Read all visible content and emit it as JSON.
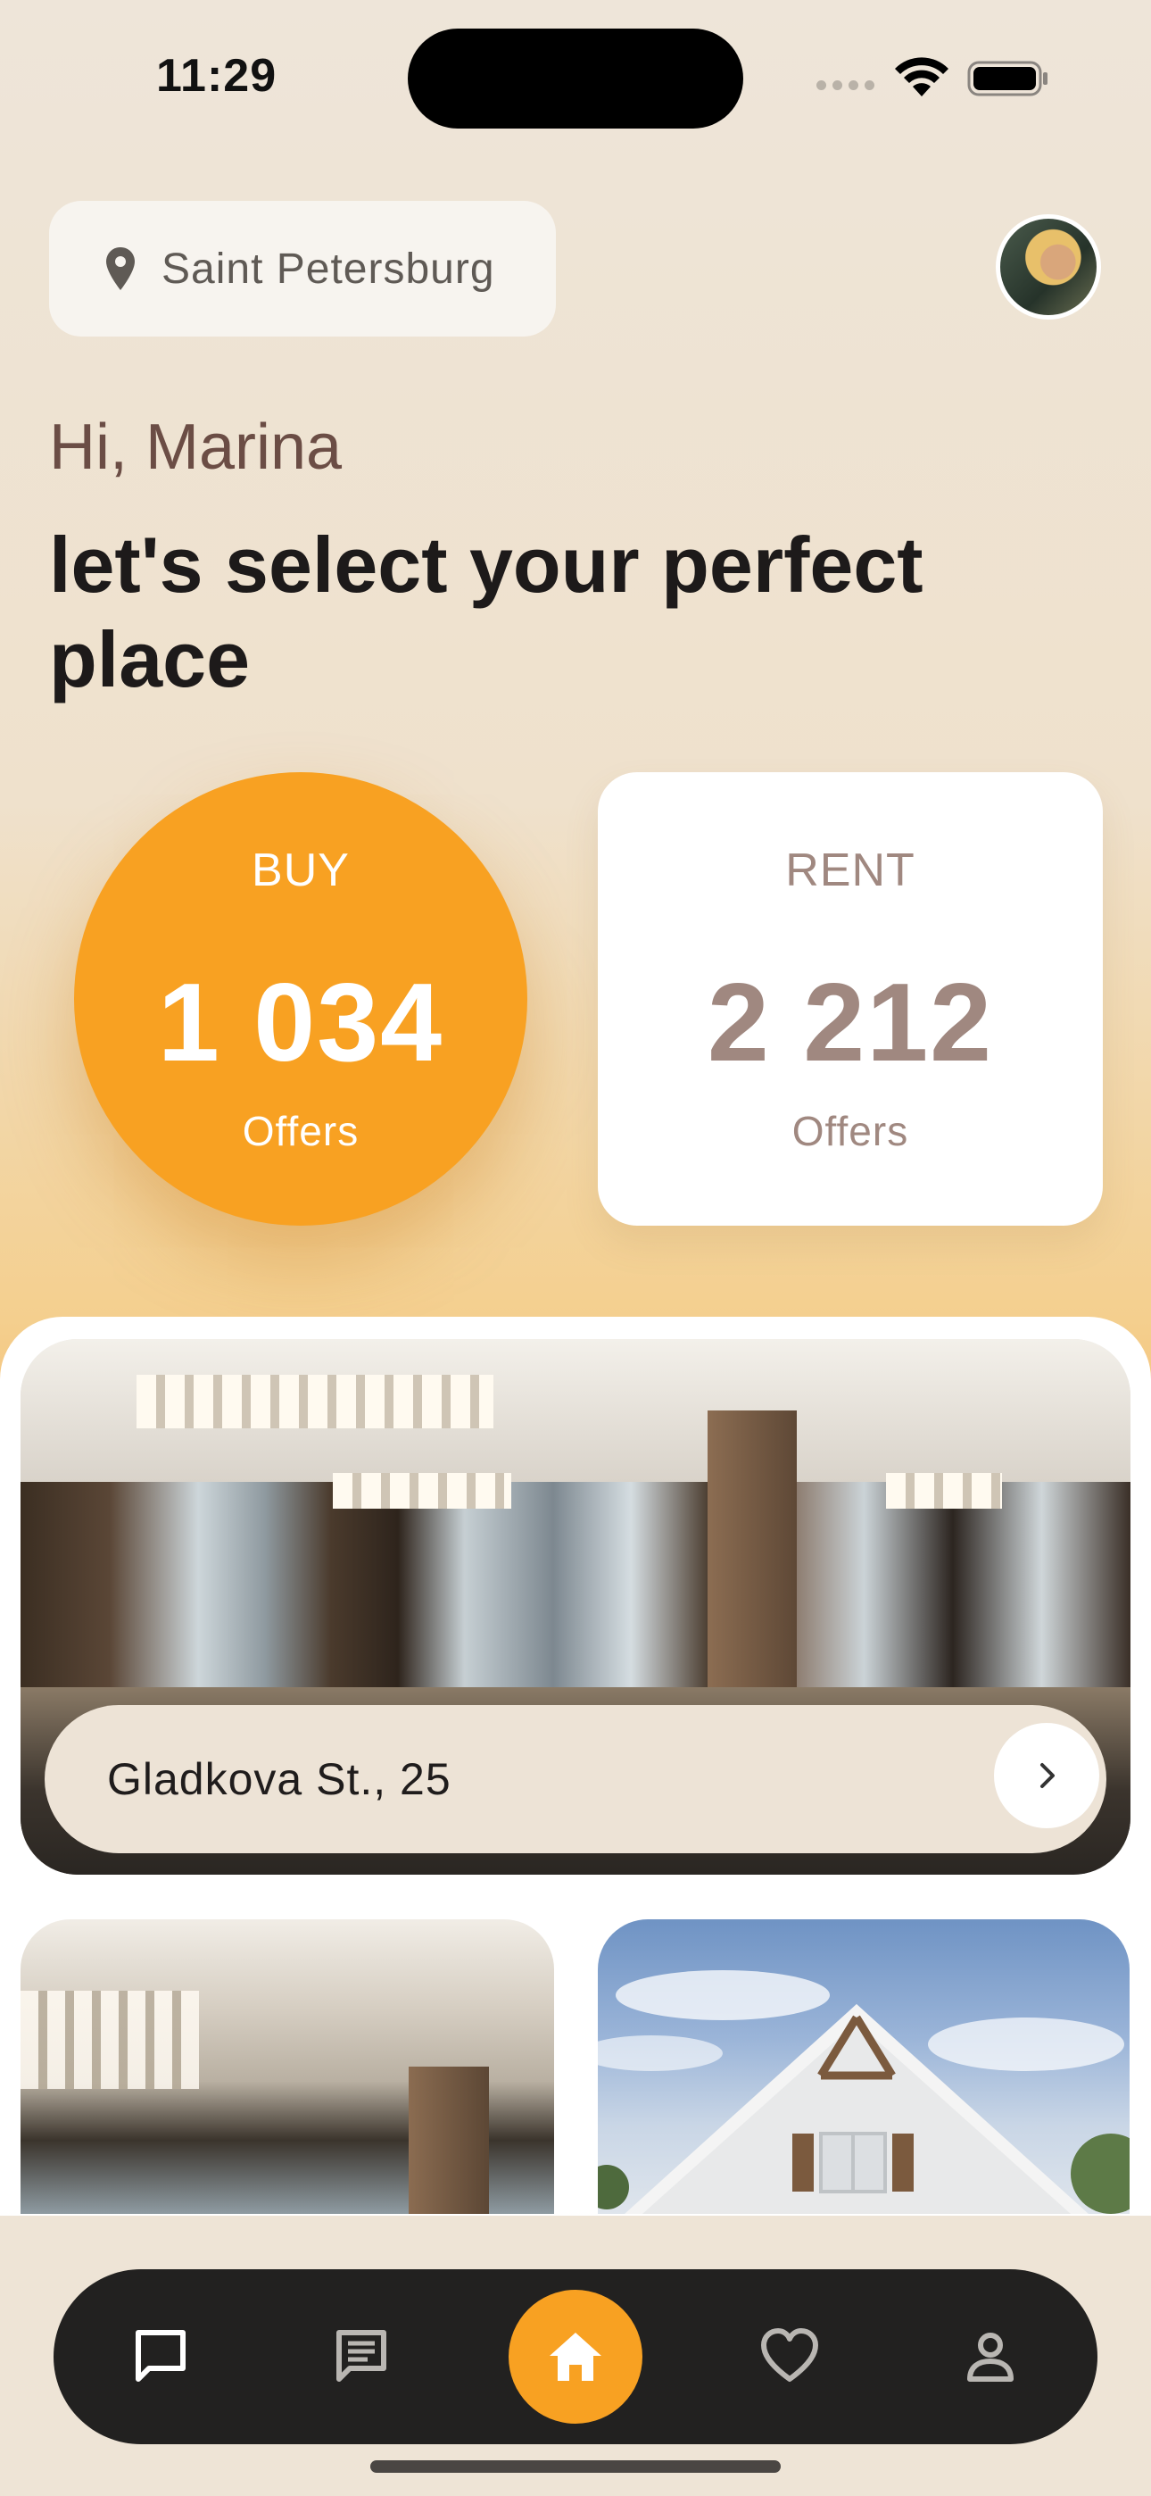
{
  "status_bar": {
    "time": "11:29"
  },
  "location": {
    "city": "Saint Petersburg",
    "icon": "location-pin-icon"
  },
  "greeting": "Hi, Marina",
  "headline": "let's select your perfect place",
  "offers": {
    "buy": {
      "label": "BUY",
      "count": "1 034",
      "sub": "Offers"
    },
    "rent": {
      "label": "RENT",
      "count": "2 212",
      "sub": "Offers"
    }
  },
  "featured": {
    "address": "Gladkova St., 25",
    "arrow_icon": "chevron-right-icon"
  },
  "nav": {
    "items": [
      "chat-bubble-icon",
      "message-list-icon",
      "home-icon",
      "heart-icon",
      "profile-icon"
    ],
    "active": "home-icon"
  },
  "colors": {
    "accent": "#f8a122",
    "nav_bg": "#222120",
    "rent_text": "#a08880"
  }
}
